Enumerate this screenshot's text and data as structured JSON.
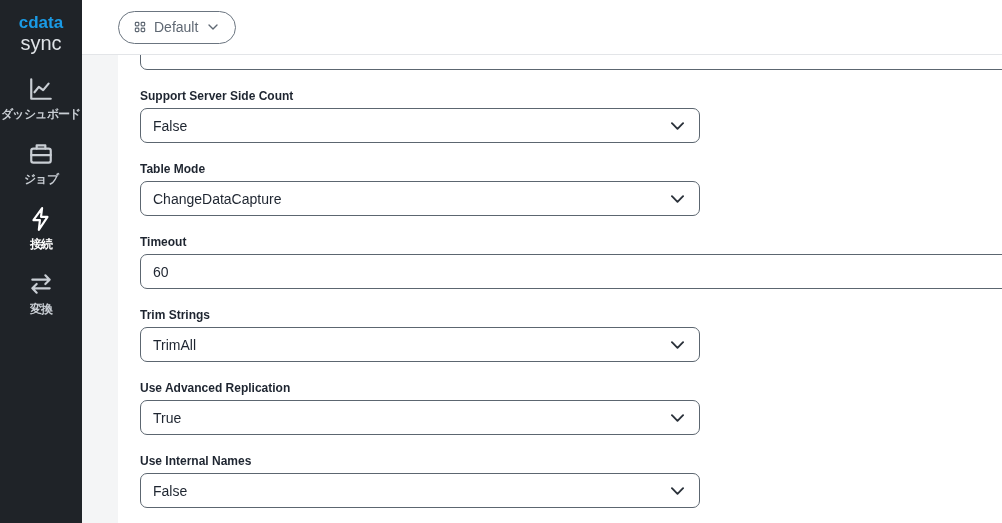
{
  "logo": {
    "brand": "cdata",
    "product": "sync"
  },
  "nav": [
    {
      "label": "ダッシュボード",
      "selected": false
    },
    {
      "label": "ジョブ",
      "selected": false
    },
    {
      "label": "接続",
      "selected": true
    },
    {
      "label": "変換",
      "selected": false
    }
  ],
  "header": {
    "workspace": "Default"
  },
  "fields": [
    {
      "kind": "text"
    },
    {
      "kind": "select",
      "label": "Support Server Side Count",
      "value": "False"
    },
    {
      "kind": "select",
      "label": "Table Mode",
      "value": "ChangeDataCapture"
    },
    {
      "kind": "text",
      "label": "Timeout",
      "value": "60"
    },
    {
      "kind": "select",
      "label": "Trim Strings",
      "value": "TrimAll"
    },
    {
      "kind": "select",
      "label": "Use Advanced Replication",
      "value": "True"
    },
    {
      "kind": "select",
      "label": "Use Internal Names",
      "value": "False"
    }
  ]
}
